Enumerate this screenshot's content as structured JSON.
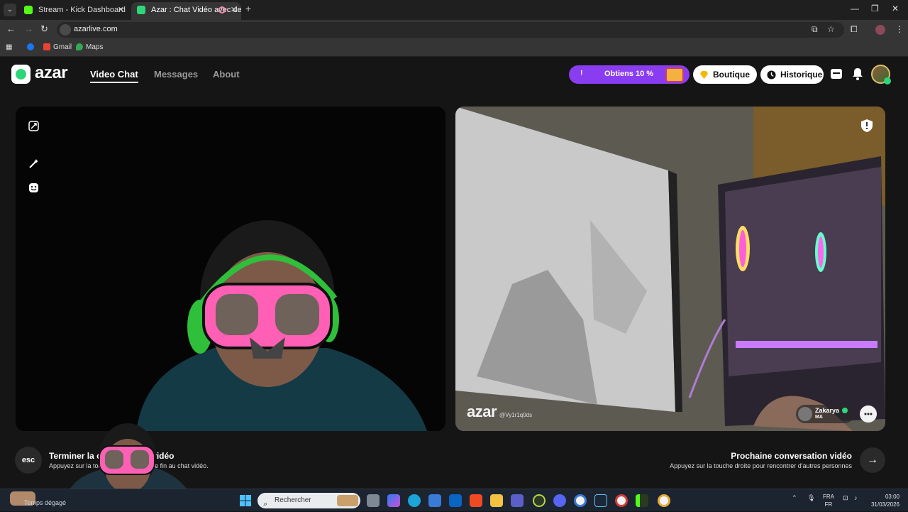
{
  "browser": {
    "tabs": [
      {
        "title": "Stream - Kick Dashboard",
        "favicon_color": "#53fc18"
      },
      {
        "title": "Azar : Chat Vidéo avec de n",
        "favicon_color": "#2ed67a",
        "active": true
      }
    ],
    "new_tab": "+",
    "window_controls": [
      "—",
      "❐",
      "✕"
    ],
    "url": "azarlive.com",
    "bookmarks": [
      {
        "label": "",
        "color": "#1877f2"
      },
      {
        "label": "Gmail",
        "color": "#ea4335"
      },
      {
        "label": "Maps",
        "color": "#34a853"
      }
    ]
  },
  "azar": {
    "logo": "azar",
    "nav": [
      {
        "label": "Video Chat",
        "active": true
      },
      {
        "label": "Messages",
        "active": false
      },
      {
        "label": "About",
        "active": false
      }
    ],
    "promo": {
      "label": "Obtiens 10 %",
      "mark": "!"
    },
    "boutique": "Boutique",
    "historique": "Historique",
    "accent": "#2ed67a",
    "promo_color": "#8a3cf0"
  },
  "video": {
    "watermark": "azar",
    "watermark_id": "@Vy1r1q0ds",
    "partner": {
      "name": "Zakarya",
      "country": "MA"
    }
  },
  "bottom": {
    "esc_key": "esc",
    "end_title": "Terminer la conversation vidéo",
    "end_sub": "Appuyez sur la touche esc pour mettre fin au chat vidéo.",
    "next_title": "Prochaine conversation vidéo",
    "next_sub": "Appuyez sur la touche droite pour rencontrer d'autres personnes",
    "next_arrow": "→"
  },
  "taskbar": {
    "weather": "Temps dégagé",
    "search_placeholder": "Rechercher",
    "lang_top": "FRA",
    "lang_bottom": "FR",
    "time": "03:00",
    "date": "31/03/2026"
  }
}
